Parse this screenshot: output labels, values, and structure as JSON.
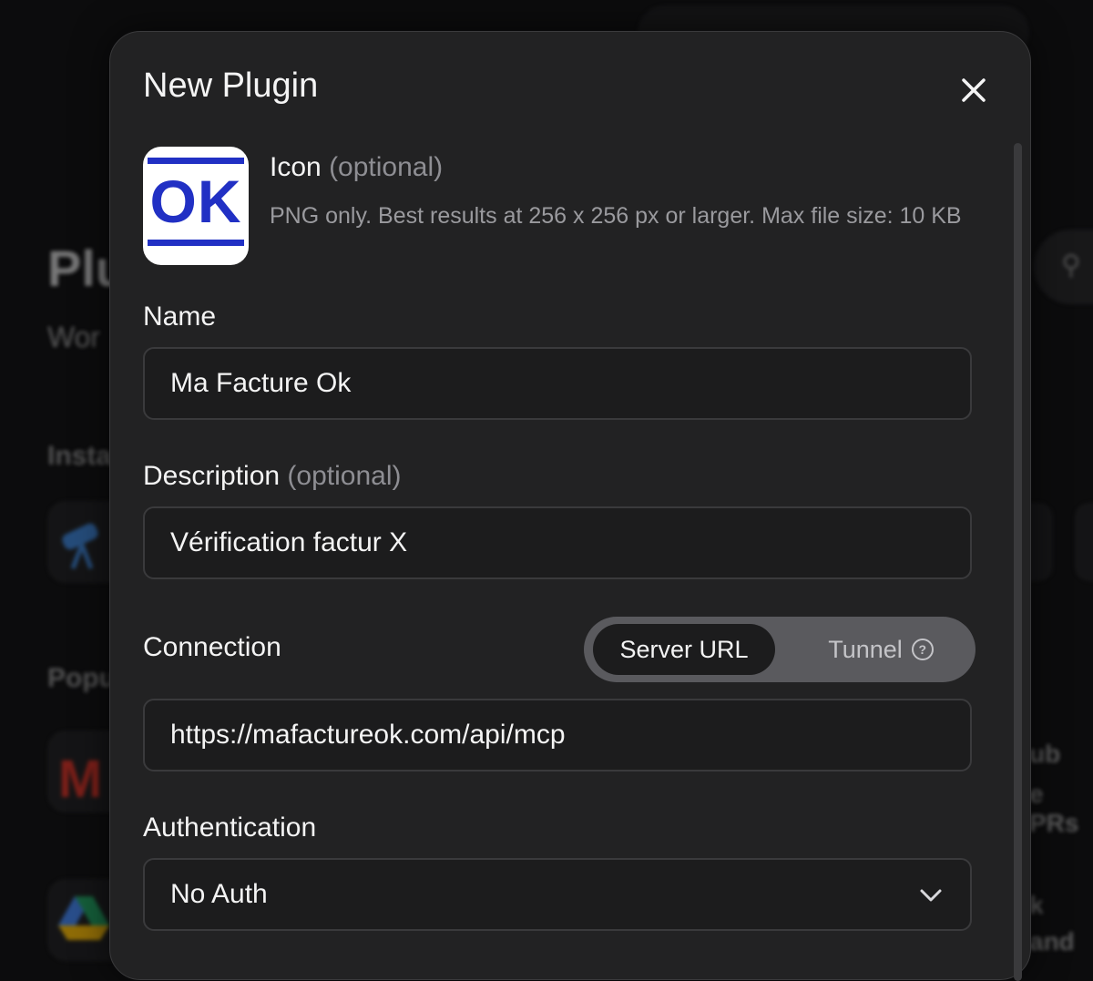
{
  "background": {
    "title": "Plu",
    "subtitle": "Wor",
    "section_installed": "Insta",
    "section_popular": "Popu",
    "right_fragment_1": "ub",
    "right_fragment_2": "e PRs",
    "right_fragment_3": "k",
    "right_fragment_4": "and",
    "gmail_glyph": "M"
  },
  "modal": {
    "title": "New Plugin",
    "icon": {
      "label": "Icon",
      "optional": "(optional)",
      "help": "PNG only. Best results at 256 x 256 px or larger. Max file size: 10 KB",
      "preview_text": "OK"
    },
    "name": {
      "label": "Name",
      "value": "Ma Facture Ok"
    },
    "description": {
      "label": "Description",
      "optional": "(optional)",
      "value": "Vérification factur X"
    },
    "connection": {
      "label": "Connection",
      "options": [
        "Server URL",
        "Tunnel"
      ],
      "selected": "Server URL",
      "value": "https://mafactureok.com/api/mcp"
    },
    "authentication": {
      "label": "Authentication",
      "selected": "No Auth"
    }
  },
  "colors": {
    "icon_blue": "#2130c4",
    "modal_bg": "#222223",
    "gmail_red": "#d93025"
  }
}
